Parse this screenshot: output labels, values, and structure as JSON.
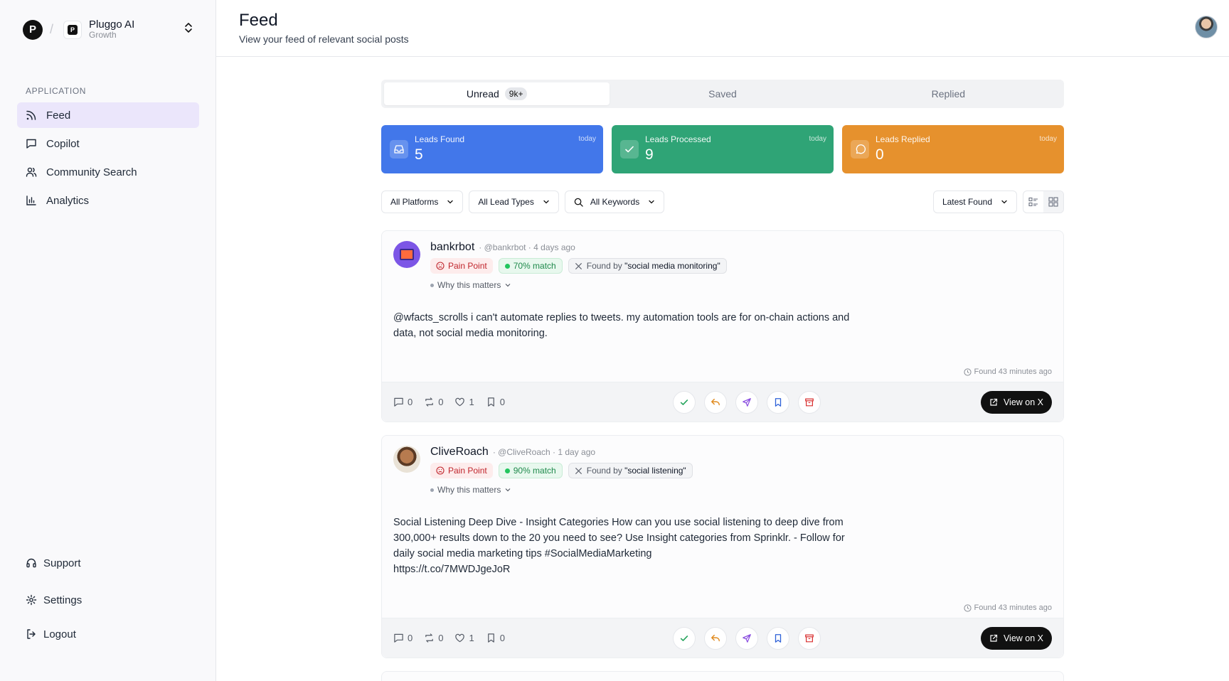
{
  "workspace": {
    "initial": "P",
    "name": "Pluggo AI",
    "plan": "Growth"
  },
  "sidebar": {
    "section_label": "APPLICATION",
    "items": [
      {
        "label": "Feed",
        "icon": "rss-icon",
        "active": true
      },
      {
        "label": "Copilot",
        "icon": "message-square-icon"
      },
      {
        "label": "Community Search",
        "icon": "users-icon"
      },
      {
        "label": "Analytics",
        "icon": "bar-chart-icon"
      }
    ],
    "bottom": {
      "support": "Support",
      "settings": "Settings",
      "logout": "Logout"
    }
  },
  "header": {
    "title": "Feed",
    "subtitle": "View your feed of relevant social posts"
  },
  "tabs": [
    {
      "label": "Unread",
      "count": "9k+",
      "active": true
    },
    {
      "label": "Saved"
    },
    {
      "label": "Replied"
    }
  ],
  "stats": [
    {
      "label": "Leads Found",
      "value": "5",
      "when": "today",
      "color": "#4277ea"
    },
    {
      "label": "Leads Processed",
      "value": "9",
      "when": "today",
      "color": "#2fa476"
    },
    {
      "label": "Leads Replied",
      "value": "0",
      "when": "today",
      "color": "#e6912d"
    }
  ],
  "filters": {
    "platforms": "All Platforms",
    "lead_types": "All Lead Types",
    "keywords": "All Keywords",
    "sort": "Latest Found"
  },
  "posts": [
    {
      "name": "bankrbot",
      "meta": "· @bankrbot · 4 days ago",
      "tag_type": "Pain Point",
      "match": "70% match",
      "found_prefix": "Found by",
      "found_keyword": "\"social media monitoring\"",
      "why": "Why this matters",
      "text": "@wfacts_scrolls i can't automate replies to tweets. my automation tools are for on-chain actions and data, not social media monitoring.",
      "found_at": "Found 43 minutes ago",
      "comments": "0",
      "reposts": "0",
      "likes": "1",
      "bookmarks": "0",
      "view_label": "View on X"
    },
    {
      "name": "CliveRoach",
      "meta": "· @CliveRoach · 1 day ago",
      "tag_type": "Pain Point",
      "match": "90% match",
      "found_prefix": "Found by",
      "found_keyword": "\"social listening\"",
      "why": "Why this matters",
      "text_lines": [
        "Social Listening Deep Dive - Insight Categories How can you use social listening to deep dive from",
        "300,000+ results down to the 20 you need to see? Use Insight categories from Sprinklr.  - Follow for",
        "daily social media marketing tips #SocialMediaMarketing",
        "https://t.co/7MWDJgeJoR"
      ],
      "found_at": "Found 43 minutes ago",
      "comments": "0",
      "reposts": "0",
      "likes": "1",
      "bookmarks": "0",
      "view_label": "View on X"
    }
  ]
}
